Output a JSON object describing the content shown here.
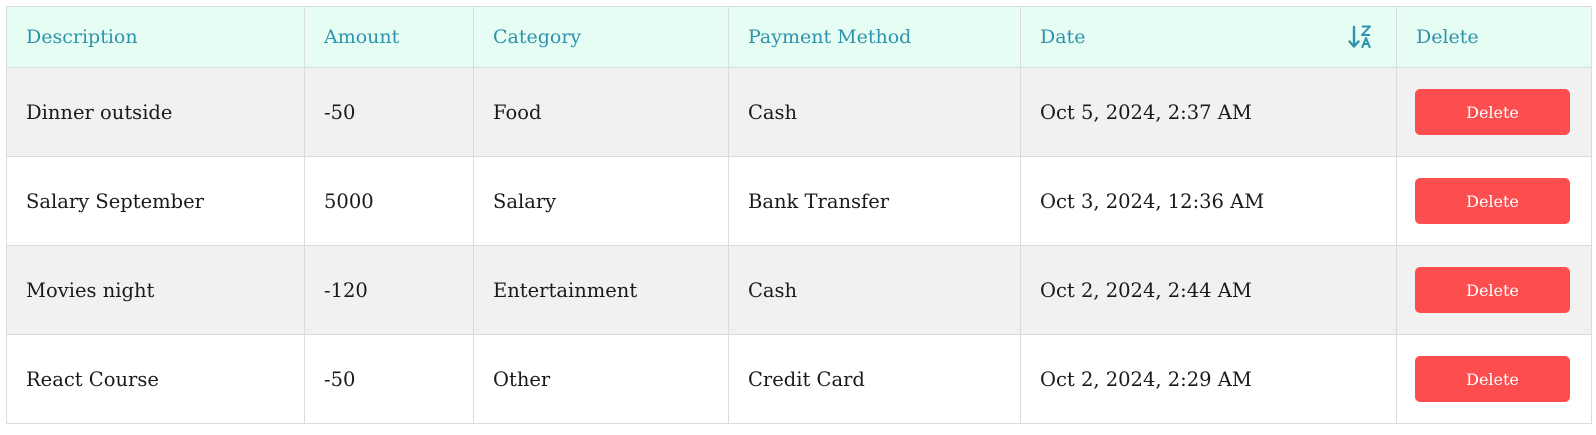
{
  "headers": {
    "description": "Description",
    "amount": "Amount",
    "category": "Category",
    "payment_method": "Payment Method",
    "date": "Date",
    "delete": "Delete"
  },
  "sort": {
    "icon": "sort-z-a-icon",
    "direction": "descending"
  },
  "rows": [
    {
      "description": "Dinner outside",
      "amount": "-50",
      "category": "Food",
      "payment_method": "Cash",
      "date": "Oct 5, 2024, 2:37 AM",
      "delete_label": "Delete"
    },
    {
      "description": "Salary September",
      "amount": "5000",
      "category": "Salary",
      "payment_method": "Bank Transfer",
      "date": "Oct 3, 2024, 12:36 AM",
      "delete_label": "Delete"
    },
    {
      "description": "Movies night",
      "amount": "-120",
      "category": "Entertainment",
      "payment_method": "Cash",
      "date": "Oct 2, 2024, 2:44 AM",
      "delete_label": "Delete"
    },
    {
      "description": "React Course",
      "amount": "-50",
      "category": "Other",
      "payment_method": "Credit Card",
      "date": "Oct 2, 2024, 2:29 AM",
      "delete_label": "Delete"
    }
  ],
  "colors": {
    "header_bg": "#e6fdf3",
    "header_text": "#2e93ad",
    "delete_button": "#fd4e4f",
    "stripe": "#f1f1f1"
  }
}
